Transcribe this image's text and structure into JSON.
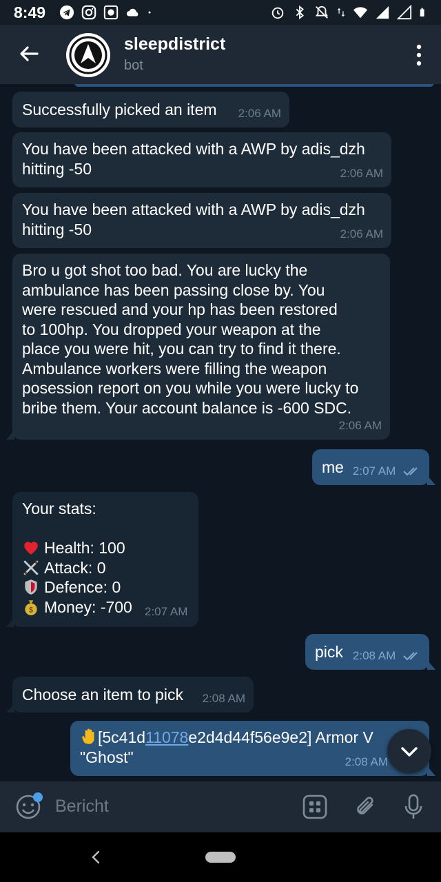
{
  "status_bar": {
    "time": "8:49",
    "left_icons": [
      "telegram-icon",
      "instagram-icon",
      "gallery-icon",
      "cloud-icon",
      "dot-icon"
    ],
    "right_icons": [
      "alarm-icon",
      "bluetooth-icon",
      "mute-icon",
      "data-arrows-icon",
      "wifi-icon",
      "signal-icon",
      "signal-empty-icon",
      "battery-icon"
    ]
  },
  "header": {
    "title": "sleepdistrict",
    "subtitle": "bot",
    "back_icon": "arrow-back-icon",
    "menu_icon": "more-vert-icon"
  },
  "messages": [
    {
      "direction": "in",
      "text": "Successfully picked an item",
      "time": "2:06 AM"
    },
    {
      "direction": "in",
      "text": "You have been attacked with a AWP by adis_dzh\nhitting -50",
      "time": "2:06 AM"
    },
    {
      "direction": "in",
      "text": "You have been attacked with a AWP by adis_dzh\nhitting -50",
      "time": "2:06 AM"
    },
    {
      "direction": "in",
      "text": "Bro u got shot too bad. You are lucky the\nambulance has been passing close by. You\nwere rescued and your hp has been restored\nto 100hp. You dropped your weapon at the\nplace you were hit, you can try to find it there.\nAmbulance workers were filling the weapon\nposession report on you while you were lucky to\nbribe them. Your account balance is -600 SDC.",
      "time": "2:06 AM"
    },
    {
      "direction": "out",
      "text": "me",
      "time": "2:07 AM"
    },
    {
      "direction": "in",
      "header": "Your stats:",
      "stats": [
        {
          "icon": "heart-icon",
          "text": "Health: 100"
        },
        {
          "icon": "crossed-swords-icon",
          "text": "Attack: 0"
        },
        {
          "icon": "shield-icon",
          "text": "Defence: 0"
        },
        {
          "icon": "money-bag-icon",
          "text": "Money: -700"
        }
      ],
      "time": "2:07 AM"
    },
    {
      "direction": "out",
      "text": "pick",
      "time": "2:08 AM"
    },
    {
      "direction": "in",
      "text": "Choose an item to pick",
      "time": "2:08 AM"
    },
    {
      "direction": "out",
      "text_prefix": "[5c41d",
      "text_link": "11078",
      "text_suffix": "e2d4d44f56e9e2] Armor V",
      "text_line2": "\"Ghost\"",
      "time": "2:08 AM",
      "icon": "raised-hand-icon"
    }
  ],
  "input": {
    "placeholder": "Bericht",
    "emoji_icon": "emoji-icon",
    "bot_command_icon": "bot-keyboard-icon",
    "attach_icon": "paperclip-icon",
    "mic_icon": "mic-icon"
  },
  "scroll_down_icon": "chevron-down-icon",
  "colors": {
    "chat_bg": "#0e1621",
    "incoming_bubble": "#182533",
    "outgoing_bubble": "#2b5278",
    "header_bg": "#1f2936",
    "link": "#71a9e8"
  }
}
